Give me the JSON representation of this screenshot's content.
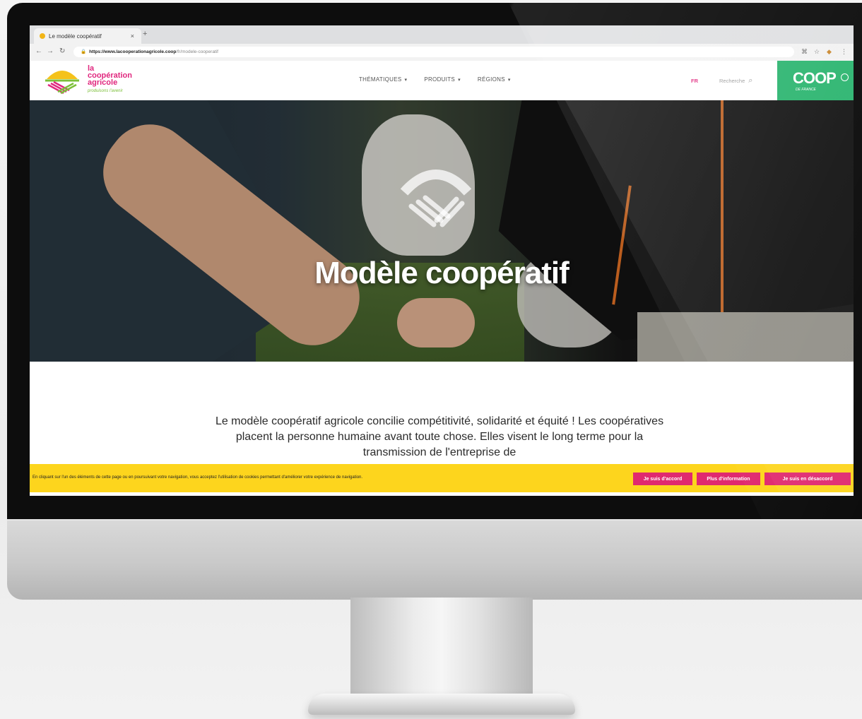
{
  "browser": {
    "tab_title": "Le modèle coopératif",
    "tab_close": "×",
    "new_tab": "+",
    "url_host": "https://www.lacooperationagricole.coop",
    "url_path": "/fr/modele-cooperatif",
    "icons": [
      "back-icon",
      "forward-icon",
      "reload-icon",
      "lock-icon",
      "translate-icon",
      "star-icon",
      "extension-icon",
      "menu-icon"
    ]
  },
  "site": {
    "logo": {
      "line1": "la",
      "line2": "coopération",
      "line3": "agricole",
      "tagline": "produisons l'avenir"
    },
    "nav": [
      {
        "label": "THÉMATIQUES"
      },
      {
        "label": "PRODUITS"
      },
      {
        "label": "RÉGIONS"
      }
    ],
    "lang": "FR",
    "search_label": "Recherche",
    "coop_badge": {
      "big": "COOP",
      "small": "DE FRANCE"
    }
  },
  "hero": {
    "title": "Modèle coopératif"
  },
  "intro": {
    "text": "Le modèle coopératif agricole concilie compétitivité, solidarité et équité ! Les coopératives placent la personne humaine avant toute chose. Elles visent le long terme pour la transmission de l'entreprise de"
  },
  "cookie": {
    "text": "En cliquant sur l'un des éléments de cette page ou en poursuivant votre navigation, vous acceptez l'utilisation de cookies permettant d'améliorer votre expérience de navigation.",
    "accept": "Je suis d'accord",
    "more": "Plus d'information",
    "decline": "Je suis en désaccord"
  },
  "colors": {
    "brand_pink": "#e0277e",
    "brand_green": "#26b36c",
    "cookie_yellow": "#fdd51d",
    "button_pink": "#e0296f"
  }
}
